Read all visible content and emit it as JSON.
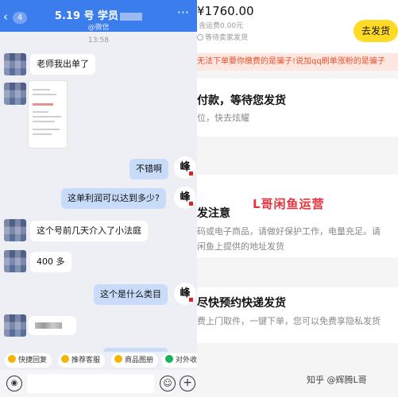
{
  "chat": {
    "header": {
      "back_glyph": "‹",
      "unread_count": "4",
      "title": "5.19 号 学员",
      "subtitle": "@微信",
      "more_glyph": "···",
      "color": "#3b7dec"
    },
    "timestamp": "13:58",
    "messages": [
      {
        "from": "them",
        "text": "老师我出单了"
      },
      {
        "from": "them",
        "type": "image"
      },
      {
        "from": "me",
        "text": "不错啊"
      },
      {
        "from": "me",
        "text": "这单利润可以达到多少?"
      },
      {
        "from": "them",
        "text": "这个号前几天介入了小法庭"
      },
      {
        "from": "them",
        "text": "400 多"
      },
      {
        "from": "me",
        "text": "这个是什么类目"
      },
      {
        "from": "them",
        "type": "blurred"
      }
    ],
    "quick_replies": [
      {
        "label": "快捷回复",
        "icon": "lightning-icon"
      },
      {
        "label": "推荐客服",
        "icon": "service-icon"
      },
      {
        "label": "商品图册",
        "icon": "album-icon"
      },
      {
        "label": "对外收",
        "icon": "shield-icon"
      }
    ],
    "input_bar": {
      "voice": "◉",
      "emoji": "☺",
      "plus": "+"
    },
    "bubble_out_color": "#c8dcfa",
    "bubble_in_color": "#ffffff",
    "avatar_seal": "峰"
  },
  "order": {
    "price": "¥1760.00",
    "shipping_fee": "含运费0.00元",
    "waiting_seller": "等待卖家发货",
    "ship_button": "去发货",
    "warning": "无法下单要你缴费的是骗子!说加qq刷单涨粉的是骗子",
    "status_title": "付款，等待您发货",
    "status_desc": "位，快去炫耀",
    "notice_title": "发注意",
    "notice_desc": "码或电子商品，请做好保护工作，电量充足。请",
    "notice_desc2": "闲鱼上提供的地址发货",
    "express_title": "尽快预约快递发货",
    "express_desc": "费上门取件，一键下单，您可以免费享隐私发货",
    "button_color": "#ffdb26",
    "warning_color": "#e5502c"
  },
  "watermark": "L哥闲鱼运营",
  "credit": "知乎 @辉腾L哥"
}
